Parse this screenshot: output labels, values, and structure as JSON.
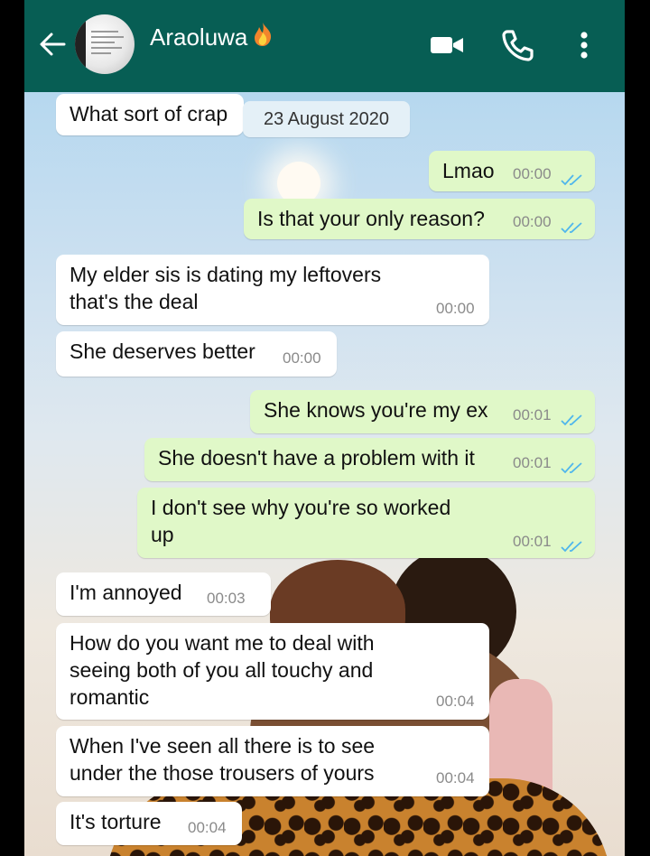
{
  "header": {
    "contact_name": "Araoluwa",
    "colors": {
      "bar": "#075e54",
      "icons": "#ffffff"
    },
    "icons": [
      "back-arrow-icon",
      "avatar",
      "fire-emoji-icon",
      "video-call-icon",
      "voice-call-icon",
      "more-options-icon"
    ]
  },
  "chat": {
    "date_label": "23 August 2020",
    "colors": {
      "incoming": "#ffffff",
      "outgoing": "#e0f8c8",
      "read_ticks": "#4fb6ec"
    },
    "messages": [
      {
        "dir": "in",
        "text": "What sort of crap",
        "time": ""
      },
      {
        "dir": "out",
        "text": "Lmao",
        "time": "00:00",
        "ticks": "read"
      },
      {
        "dir": "out",
        "text": "Is that your only reason?",
        "time": "00:00",
        "ticks": "read"
      },
      {
        "dir": "in",
        "text": "My elder sis is dating my leftovers\nthat's the deal",
        "time": "00:00"
      },
      {
        "dir": "in",
        "text": "She deserves better",
        "time": "00:00"
      },
      {
        "dir": "out",
        "text": "She knows you're my ex",
        "time": "00:01",
        "ticks": "read"
      },
      {
        "dir": "out",
        "text": "She doesn't have a problem with it",
        "time": "00:01",
        "ticks": "read"
      },
      {
        "dir": "out",
        "text": "I don't see why you're so worked\nup",
        "time": "00:01",
        "ticks": "read"
      },
      {
        "dir": "in",
        "text": "I'm annoyed",
        "time": "00:03"
      },
      {
        "dir": "in",
        "text": "How do you want me to deal with\nseeing both of you all touchy and\nromantic",
        "time": "00:04"
      },
      {
        "dir": "in",
        "text": "When I've seen all there is to see\nunder the those trousers of yours",
        "time": "00:04"
      },
      {
        "dir": "in",
        "text": "It's torture",
        "time": "00:04"
      }
    ]
  }
}
